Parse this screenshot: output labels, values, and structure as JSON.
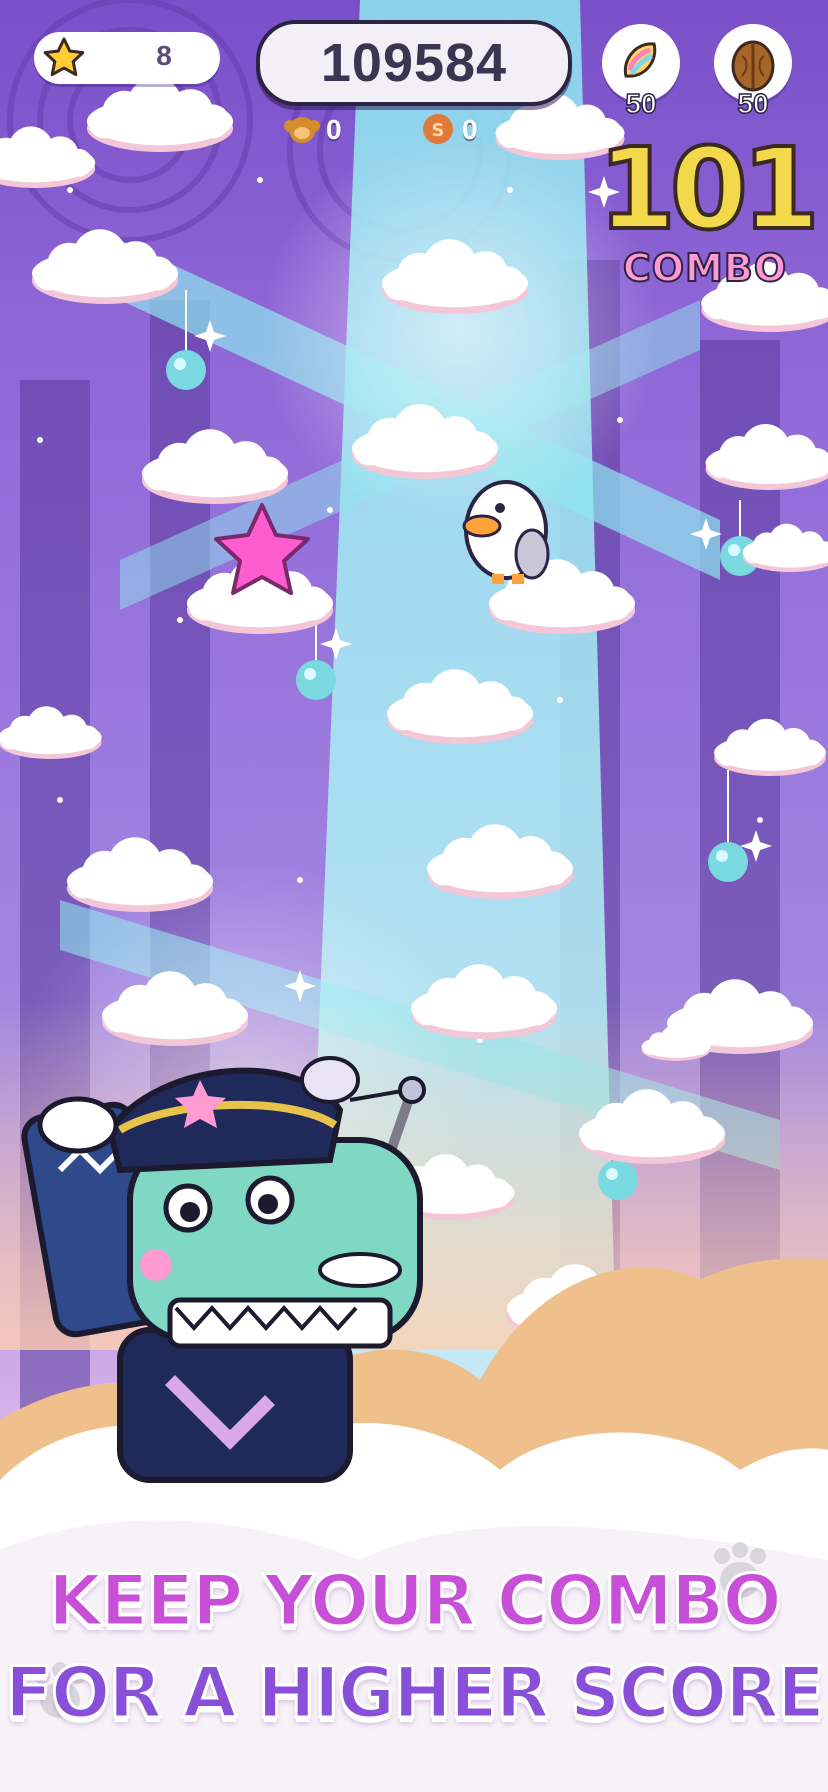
{
  "hud": {
    "stars": "8",
    "score": "109584",
    "monkey_count": "0",
    "coin_count": "0",
    "items": [
      {
        "name": "rainbow-feather",
        "count": "50"
      },
      {
        "name": "walnut",
        "count": "50"
      }
    ]
  },
  "combo": {
    "value": "101",
    "label": "COMBO"
  },
  "tagline": {
    "line1": "KEEP YOUR COMBO",
    "line2": "FOR A HIGHER SCORE"
  },
  "colors": {
    "sky_top": "#7a4fc9",
    "light_beam": "#7fe0ea",
    "combo_gold": "#f2d84a",
    "combo_pink": "#ff9bd2",
    "tagline_pink": "#c84fd8",
    "tagline_purple": "#8a4fd8"
  }
}
